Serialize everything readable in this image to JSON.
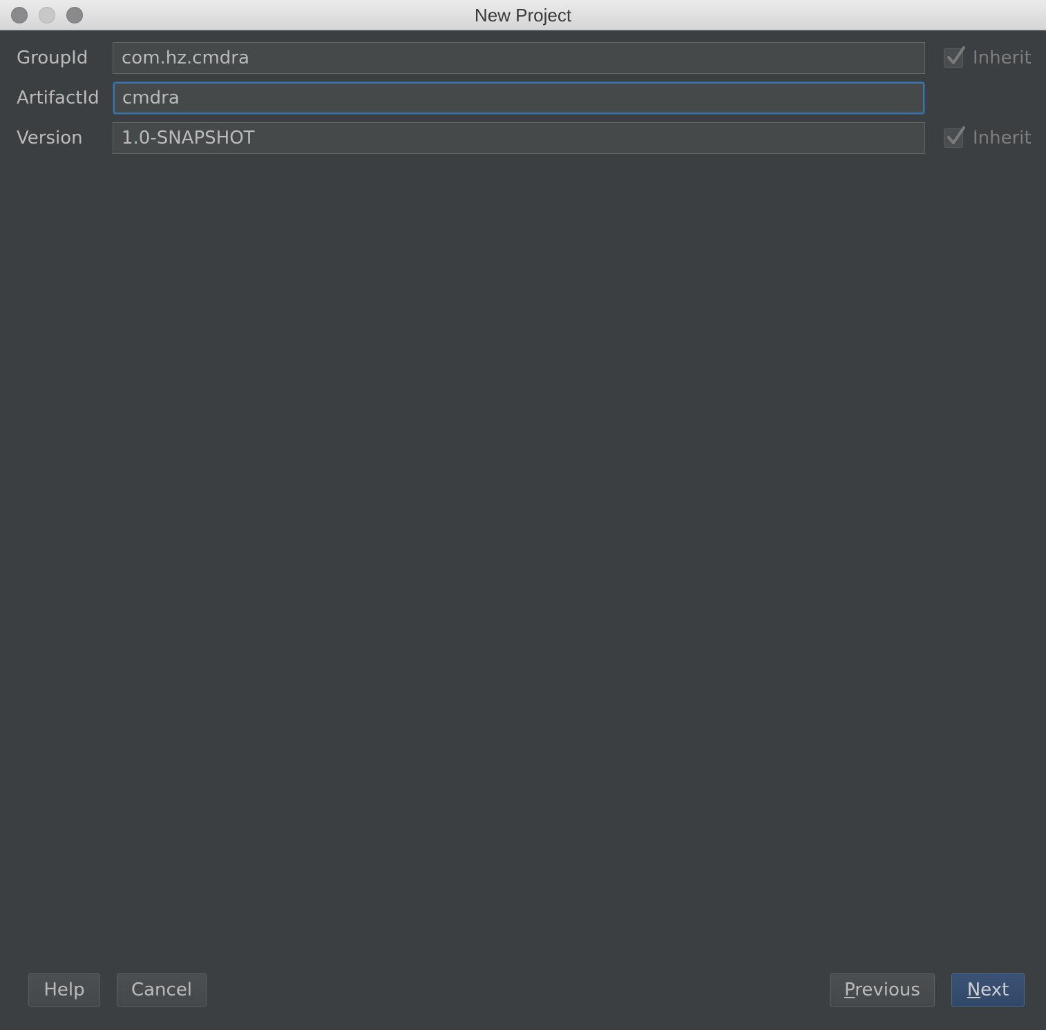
{
  "window": {
    "title": "New Project"
  },
  "form": {
    "group_id": {
      "label": "GroupId",
      "value": "com.hz.cmdra",
      "inherit_label": "Inherit",
      "inherit_checked": true
    },
    "artifact_id": {
      "label": "ArtifactId",
      "value": "cmdra"
    },
    "version": {
      "label": "Version",
      "value": "1.0-SNAPSHOT",
      "inherit_label": "Inherit",
      "inherit_checked": true
    }
  },
  "buttons": {
    "help": "Help",
    "cancel": "Cancel",
    "previous_mnemonic": "P",
    "previous_rest": "revious",
    "next_mnemonic": "N",
    "next_rest": "ext"
  },
  "colors": {
    "background": "#3c3f41",
    "field": "#45494a",
    "focus": "#3f74a6",
    "primary_button": "#365074"
  }
}
